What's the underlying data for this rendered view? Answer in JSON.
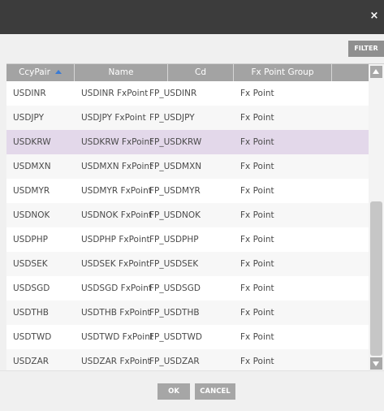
{
  "dialog": {
    "close_glyph": "×",
    "filter_label": "FILTER",
    "ok_label": "OK",
    "cancel_label": "CANCEL"
  },
  "grid": {
    "columns": [
      {
        "label": "CcyPair",
        "sorted": "asc"
      },
      {
        "label": "Name"
      },
      {
        "label": "Cd"
      },
      {
        "label": "Fx Point Group"
      }
    ],
    "rows": [
      {
        "ccy": "USDINR",
        "name": "USDINR FxPoint",
        "cd": "FP_USDINR",
        "group": "Fx Point"
      },
      {
        "ccy": "USDJPY",
        "name": "USDJPY FxPoint",
        "cd": "FP_USDJPY",
        "group": "Fx Point"
      },
      {
        "ccy": "USDKRW",
        "name": "USDKRW FxPoint",
        "cd": "FP_USDKRW",
        "group": "Fx Point",
        "selected": true
      },
      {
        "ccy": "USDMXN",
        "name": "USDMXN FxPoint",
        "cd": "FP_USDMXN",
        "group": "Fx Point"
      },
      {
        "ccy": "USDMYR",
        "name": "USDMYR FxPoint",
        "cd": "FP_USDMYR",
        "group": "Fx Point"
      },
      {
        "ccy": "USDNOK",
        "name": "USDNOK FxPoint",
        "cd": "FP_USDNOK",
        "group": "Fx Point"
      },
      {
        "ccy": "USDPHP",
        "name": "USDPHP FxPoint",
        "cd": "FP_USDPHP",
        "group": "Fx Point"
      },
      {
        "ccy": "USDSEK",
        "name": "USDSEK FxPoint",
        "cd": "FP_USDSEK",
        "group": "Fx Point"
      },
      {
        "ccy": "USDSGD",
        "name": "USDSGD FxPoint",
        "cd": "FP_USDSGD",
        "group": "Fx Point"
      },
      {
        "ccy": "USDTHB",
        "name": "USDTHB FxPoint",
        "cd": "FP_USDTHB",
        "group": "Fx Point"
      },
      {
        "ccy": "USDTWD",
        "name": "USDTWD FxPoint",
        "cd": "FP_USDTWD",
        "group": "Fx Point"
      },
      {
        "ccy": "USDZAR",
        "name": "USDZAR FxPoint",
        "cd": "FP_USDZAR",
        "group": "Fx Point"
      }
    ]
  },
  "colors": {
    "titlebar": "#3c3c3c",
    "header": "#a3a3a3",
    "selected_row": "#e3d8ea",
    "sort_arrow": "#3a7bd5",
    "button": "#a6a6a6"
  }
}
